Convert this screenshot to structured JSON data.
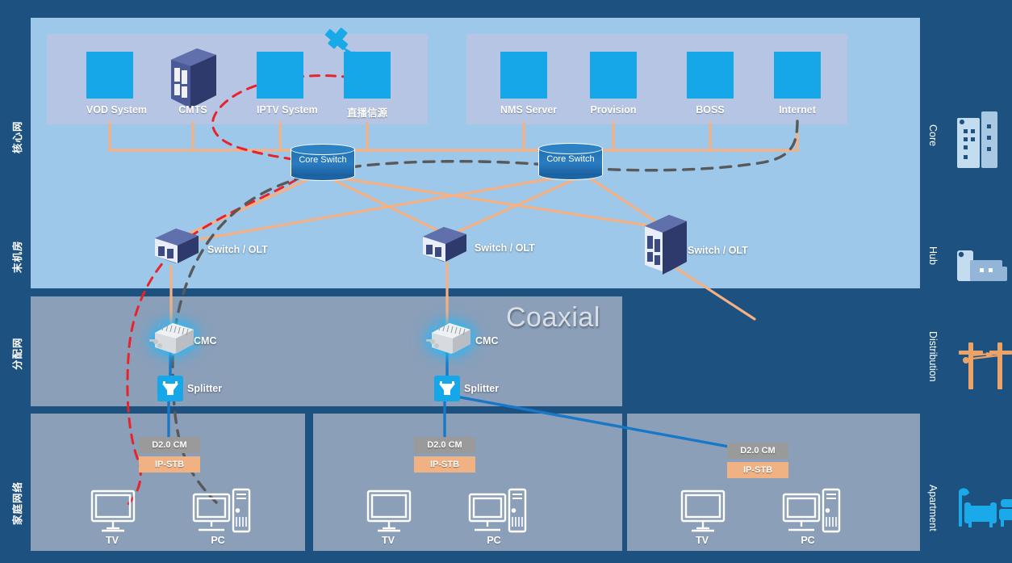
{
  "colors": {
    "background": "#1d5180",
    "core_panel": "#9ec8ea",
    "group_panel": "#b6c5e4",
    "distribution_panel": "#8b9fb9",
    "apartment_panel": "#8b9fb9",
    "icon_tile": "#15a7e8",
    "link_orange": "#f5b183",
    "link_blue": "#1878c8",
    "link_red_dashed": "#e8232a",
    "link_gray_dashed": "#58595b",
    "cm_chip": "#9a9a9a",
    "stb_chip": "#f0b183",
    "cylinder": "#2a7cc0"
  },
  "left_rail": [
    {
      "label": "核心网",
      "name": "core-network"
    },
    {
      "label": "末机房",
      "name": "hub-room"
    },
    {
      "label": "分配网",
      "name": "distribution-network"
    },
    {
      "label": "家庭网络",
      "name": "home-network"
    }
  ],
  "right_rail": [
    {
      "label": "Core",
      "icon": "office-building-icon"
    },
    {
      "label": "Hub",
      "icon": "hub-building-icon"
    },
    {
      "label": "Distribution",
      "icon": "utility-pole-icon"
    },
    {
      "label": "Apartment",
      "icon": "living-room-furniture-icon"
    }
  ],
  "core_group_left": {
    "nodes": [
      {
        "label": "VOD System",
        "icon": "globe-network-icon"
      },
      {
        "label": "CMTS",
        "icon": "server-rack-3d-icon"
      },
      {
        "label": "IPTV System",
        "icon": "media-server-play-icon"
      },
      {
        "label": "直播信源",
        "icon": "database-stack-icon"
      }
    ]
  },
  "core_group_right": {
    "nodes": [
      {
        "label": "NMS Server",
        "icon": "nms-server-icon"
      },
      {
        "label": "Provision",
        "icon": "provisioning-server-icon"
      },
      {
        "label": "BOSS",
        "icon": "boss-laptop-sync-icon"
      },
      {
        "label": "Internet",
        "icon": "internet-globe-icon"
      }
    ]
  },
  "satellite": {
    "icon": "satellite-icon"
  },
  "core_switches": [
    {
      "label": "Core Switch"
    },
    {
      "label": "Core Switch"
    }
  ],
  "hub_devices": [
    {
      "label": "Switch / OLT",
      "icon": "switch-olt-3d-icon"
    },
    {
      "label": "Switch / OLT",
      "icon": "switch-olt-3d-icon"
    },
    {
      "label": "Switch / OLT",
      "icon": "switch-olt-3d-icon"
    }
  ],
  "distribution": {
    "title": "Coaxial",
    "cmc_nodes": [
      {
        "label": "CMC",
        "icon": "cmc-amplifier-icon"
      },
      {
        "label": "CMC",
        "icon": "cmc-amplifier-icon"
      }
    ],
    "splitter_nodes": [
      {
        "label": "Splitter",
        "icon": "splitter-icon"
      },
      {
        "label": "Splitter",
        "icon": "splitter-icon"
      }
    ]
  },
  "apartments": [
    {
      "cm_label": "D2.0 CM",
      "stb_label": "IP-STB",
      "endpoints": [
        {
          "label": "TV",
          "icon": "tv-monitor-icon"
        },
        {
          "label": "PC",
          "icon": "desktop-pc-icon"
        }
      ]
    },
    {
      "cm_label": "D2.0 CM",
      "stb_label": "IP-STB",
      "endpoints": [
        {
          "label": "TV",
          "icon": "tv-monitor-icon"
        },
        {
          "label": "PC",
          "icon": "desktop-pc-icon"
        }
      ]
    },
    {
      "cm_label": "D2.0 CM",
      "stb_label": "IP-STB",
      "endpoints": [
        {
          "label": "TV",
          "icon": "tv-monitor-icon"
        },
        {
          "label": "PC",
          "icon": "desktop-pc-icon"
        }
      ]
    }
  ]
}
